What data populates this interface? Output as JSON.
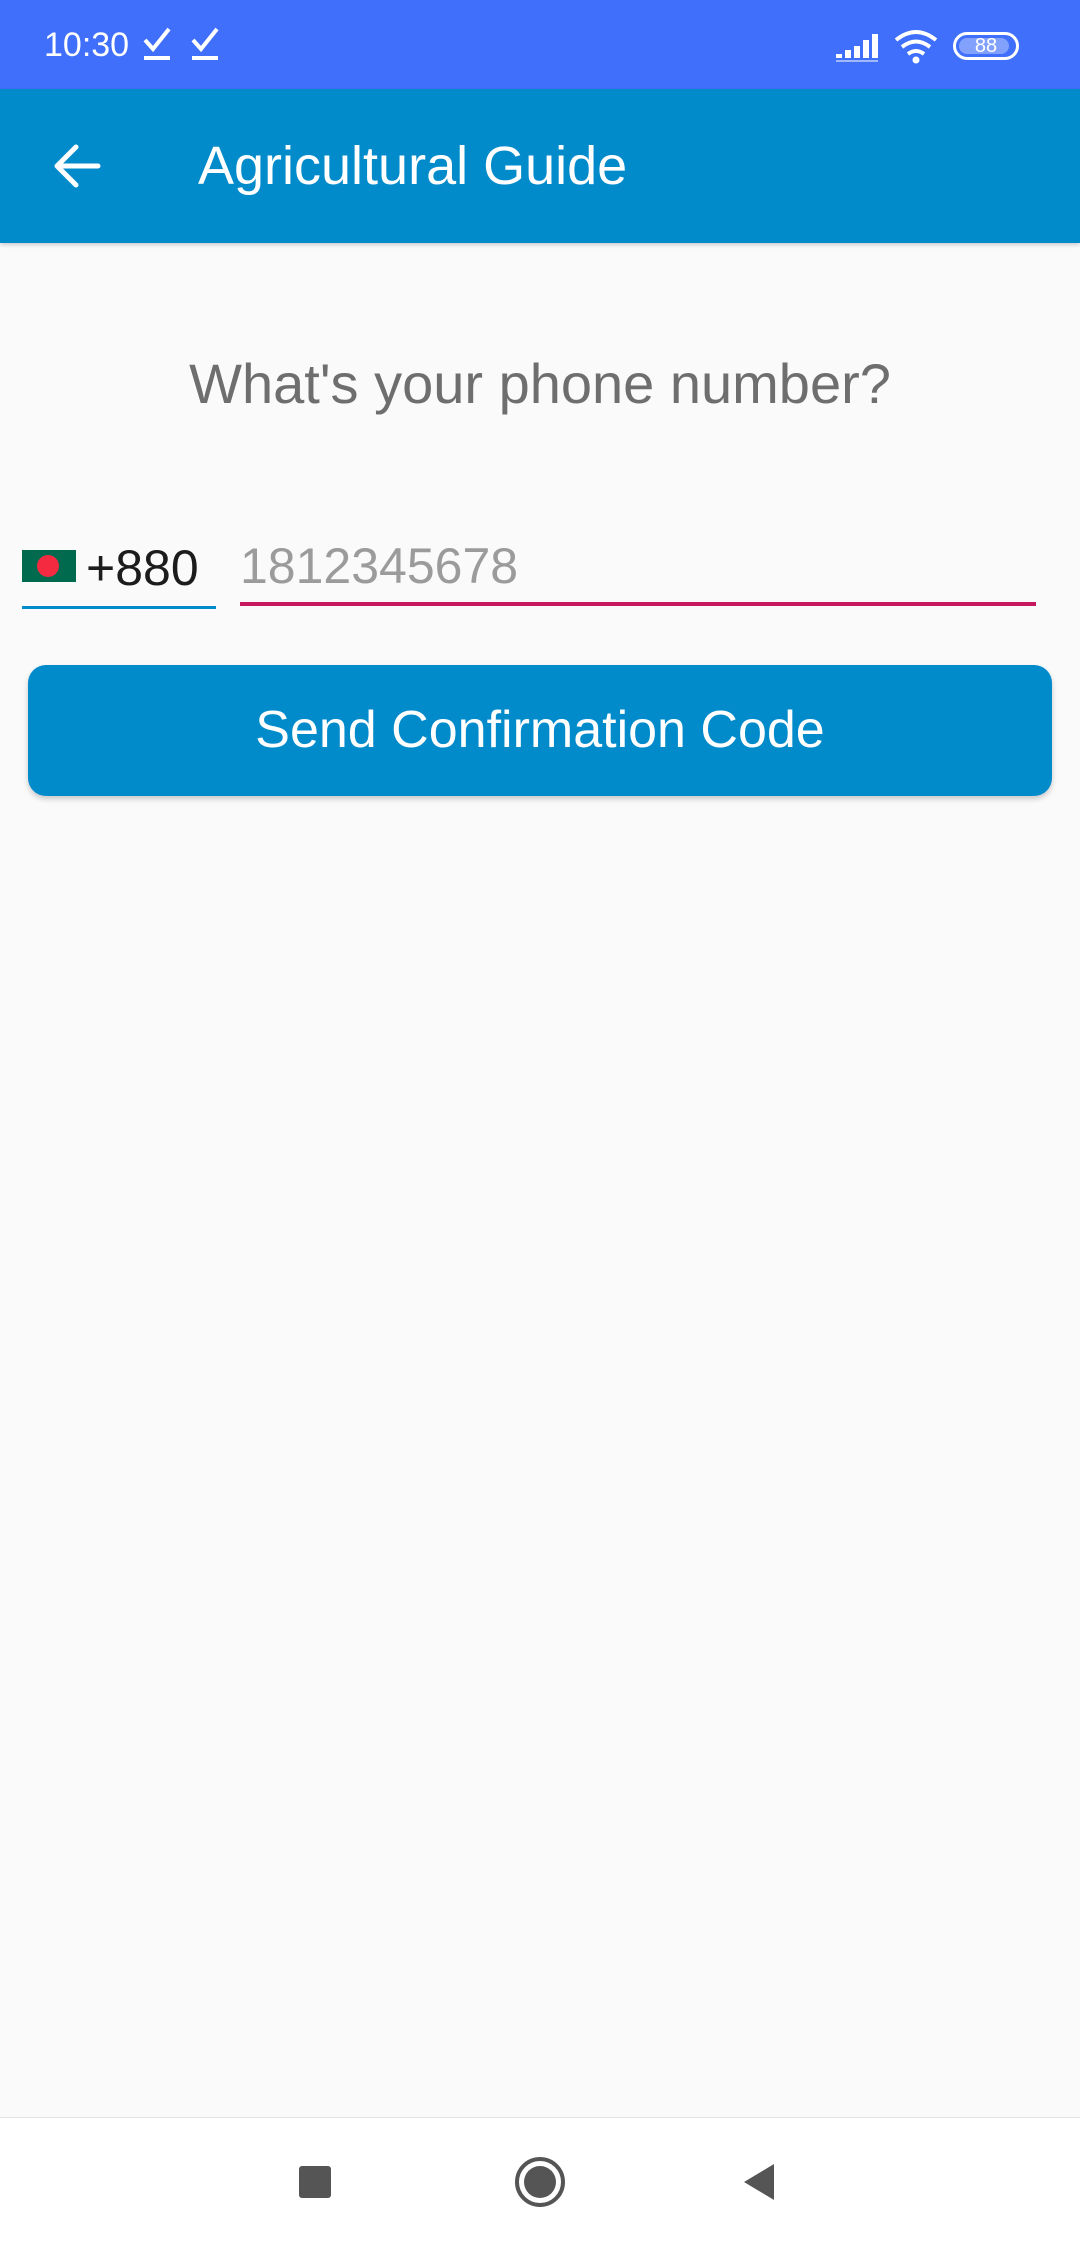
{
  "status_bar": {
    "time": "10:30",
    "battery": "88",
    "icons": [
      "check-icon",
      "check-icon",
      "signal-icon",
      "wifi-icon",
      "battery-icon"
    ]
  },
  "app_bar": {
    "title": "Agricultural Guide",
    "back_icon": "arrow-back-icon"
  },
  "main": {
    "question": "What's your phone number?",
    "country": {
      "flag_icon": "bangladesh-flag-icon",
      "code": "+880"
    },
    "phone_input": {
      "value": "",
      "placeholder": "1812345678"
    },
    "send_button_label": "Send Confirmation Code"
  },
  "nav_bar": {
    "icons": [
      "recents-square-icon",
      "home-circle-icon",
      "back-triangle-icon"
    ]
  },
  "colors": {
    "status_bar": "#3f6ffb",
    "app_bar": "#028bcb",
    "input_underline": "#c6175f",
    "button": "#028bcb"
  }
}
